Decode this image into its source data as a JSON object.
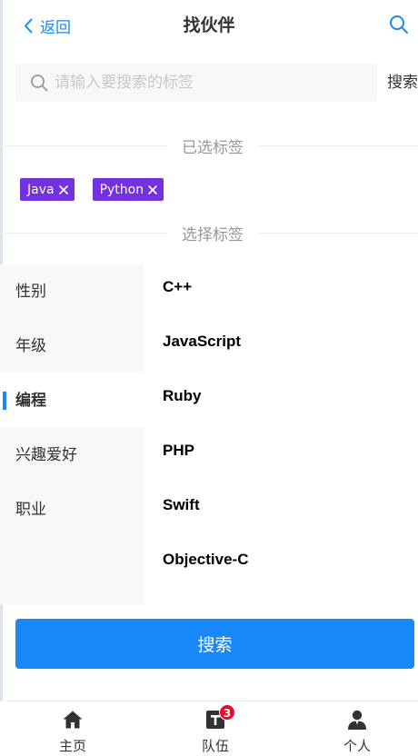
{
  "navbar": {
    "back_label": "返回",
    "title": "找伙伴",
    "search_icon": "search-icon",
    "back_icon": "chevron-left-icon"
  },
  "search": {
    "placeholder": "请输入要搜索的标签",
    "value": "",
    "action_label": "搜索"
  },
  "selected_section": {
    "title": "已选标签",
    "tags": [
      {
        "label": "Java"
      },
      {
        "label": "Python"
      }
    ]
  },
  "choose_section": {
    "title": "选择标签"
  },
  "tree": {
    "categories": [
      {
        "label": "性别",
        "active": false
      },
      {
        "label": "年级",
        "active": false
      },
      {
        "label": "编程",
        "active": true
      },
      {
        "label": "兴趣爱好",
        "active": false
      },
      {
        "label": "职业",
        "active": false
      }
    ],
    "items": [
      {
        "label": "C++"
      },
      {
        "label": "JavaScript"
      },
      {
        "label": "Ruby"
      },
      {
        "label": "PHP"
      },
      {
        "label": "Swift"
      },
      {
        "label": "Objective-C"
      }
    ]
  },
  "search_button": {
    "label": "搜索"
  },
  "tabbar": {
    "tabs": [
      {
        "label": "主页",
        "icon": "home-icon"
      },
      {
        "label": "队伍",
        "icon": "team-icon",
        "badge": "3"
      },
      {
        "label": "个人",
        "icon": "user-icon"
      }
    ]
  },
  "colors": {
    "primary": "#1989fa",
    "tag": "#7232dd",
    "badge": "#ee0a24"
  }
}
